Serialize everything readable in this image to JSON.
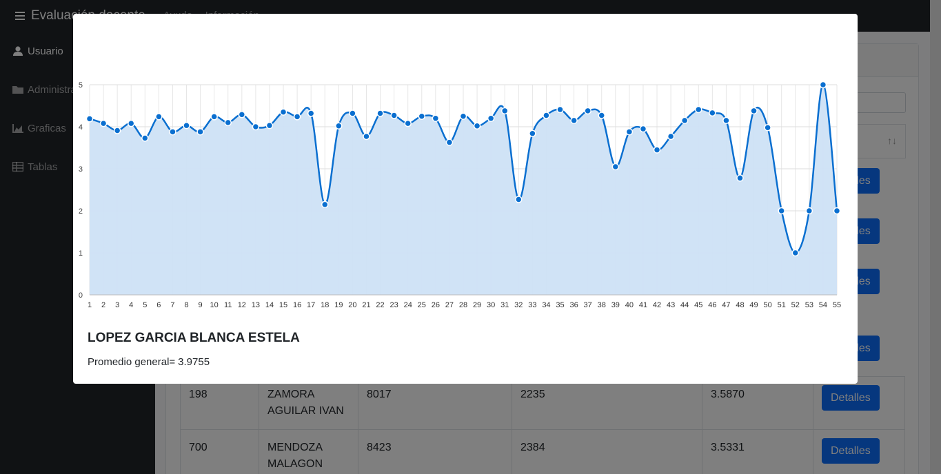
{
  "topbar": {
    "brand": "Evaluación docente",
    "nav": [
      "Ayuda",
      "Información"
    ]
  },
  "sidebar": {
    "items": [
      {
        "label": "Usuario",
        "icon": "user-icon",
        "active": true
      },
      {
        "label": "Administrar",
        "icon": "folder-icon",
        "active": false
      },
      {
        "label": "Graficas",
        "icon": "area-chart-icon",
        "active": false
      },
      {
        "label": "Tablas",
        "icon": "table-icon",
        "active": false
      }
    ]
  },
  "table": {
    "sort_icon": "↑↓",
    "button_label": "Detalles",
    "rows": [
      {
        "id": "198",
        "name": "ZAMORA AGUILAR IVAN",
        "num": "8017",
        "code": "2235",
        "avg": "3.5870"
      },
      {
        "id": "700",
        "name": "MENDOZA MALAGON",
        "num": "8423",
        "code": "2384",
        "avg": "3.5331"
      }
    ]
  },
  "modal": {
    "teacher_name": "LOPEZ GARCIA BLANCA ESTELA",
    "average_label": "Promedio general=",
    "average_value": "3.9755"
  },
  "chart_data": {
    "type": "area",
    "x": [
      1,
      2,
      3,
      4,
      5,
      6,
      7,
      8,
      9,
      10,
      11,
      12,
      13,
      14,
      15,
      16,
      17,
      18,
      19,
      20,
      21,
      22,
      23,
      24,
      25,
      26,
      27,
      28,
      29,
      30,
      31,
      32,
      33,
      34,
      35,
      36,
      37,
      38,
      39,
      40,
      41,
      42,
      43,
      44,
      45,
      46,
      47,
      48,
      49,
      50,
      51,
      52,
      53,
      54,
      55
    ],
    "values": [
      4.19,
      4.08,
      3.91,
      4.08,
      3.73,
      4.24,
      3.88,
      4.03,
      3.88,
      4.24,
      4.1,
      4.29,
      4.0,
      4.03,
      4.35,
      4.24,
      4.32,
      2.15,
      4.02,
      4.32,
      3.77,
      4.32,
      4.27,
      4.08,
      4.25,
      4.2,
      3.63,
      4.25,
      4.02,
      4.2,
      4.38,
      2.27,
      3.84,
      4.27,
      4.41,
      4.15,
      4.38,
      4.27,
      3.05,
      3.88,
      3.95,
      3.45,
      3.77,
      4.15,
      4.41,
      4.33,
      4.15,
      2.78,
      4.38,
      3.98,
      2.0,
      1.0,
      2.0,
      5.0,
      2.0
    ],
    "yticks": [
      0,
      1,
      2,
      3,
      4,
      5
    ],
    "ylim": [
      0,
      5
    ],
    "grid": true,
    "line_color": "#0a6fd0",
    "fill_color": "#cde2f6"
  }
}
